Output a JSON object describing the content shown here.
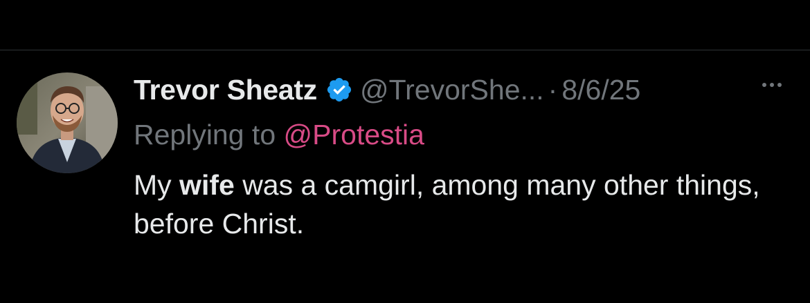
{
  "tweet": {
    "display_name": "Trevor Sheatz",
    "handle": "@TrevorShe...",
    "separator": "·",
    "date": "8/6/25",
    "verified": true,
    "verified_color": "#1d9bf0",
    "replying_to_label": "Replying to",
    "replying_to_handle": "@Protestia",
    "replying_to_color": "#d84b86",
    "text_part1": "My ",
    "text_bold": "wife",
    "text_part2": " was a camgirl, among many other things, before Christ."
  },
  "icons": {
    "more": "more-horizontal-icon",
    "verified": "verified-badge-icon"
  }
}
